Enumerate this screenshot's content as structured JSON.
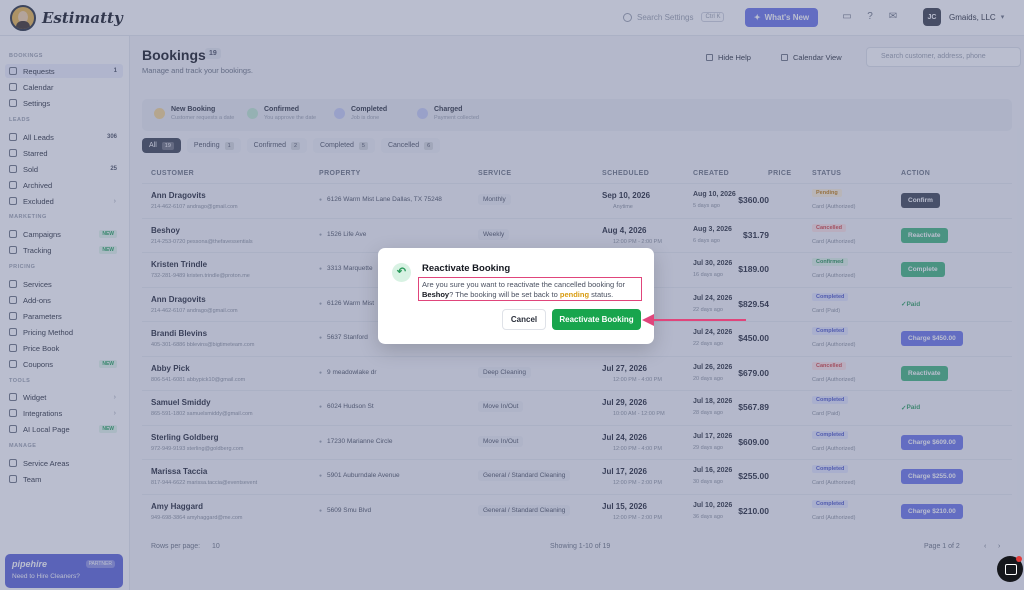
{
  "app": {
    "name": "Estimatty"
  },
  "topbar": {
    "search_placeholder": "Search Settings",
    "shortcut": "Ctrl K",
    "whats_new": "What's New",
    "account_initials": "JC",
    "account_name": "Gmaids, LLC"
  },
  "sidebar": {
    "sections": {
      "bookings": "BOOKINGS",
      "leads": "LEADS",
      "marketing": "MARKETING",
      "pricing": "PRICING",
      "tools": "TOOLS",
      "manage": "MANAGE"
    },
    "items": [
      {
        "label": "Requests",
        "badge": "1"
      },
      {
        "label": "Calendar"
      },
      {
        "label": "Settings"
      },
      {
        "label": "All Leads",
        "badge": "306"
      },
      {
        "label": "Starred"
      },
      {
        "label": "Sold",
        "badge": "25"
      },
      {
        "label": "Archived"
      },
      {
        "label": "Excluded"
      },
      {
        "label": "Campaigns",
        "new": "NEW"
      },
      {
        "label": "Tracking",
        "new": "NEW"
      },
      {
        "label": "Services"
      },
      {
        "label": "Add-ons"
      },
      {
        "label": "Parameters"
      },
      {
        "label": "Pricing Method"
      },
      {
        "label": "Price Book"
      },
      {
        "label": "Coupons",
        "new": "NEW"
      },
      {
        "label": "Widget"
      },
      {
        "label": "Integrations"
      },
      {
        "label": "AI Local Page",
        "new": "NEW"
      },
      {
        "label": "Service Areas"
      },
      {
        "label": "Team"
      }
    ],
    "promo": {
      "logo": "pipehire",
      "tag": "PARTNER",
      "text": "Need to Hire Cleaners?"
    }
  },
  "main": {
    "title": "Bookings",
    "title_count": "19",
    "subtitle": "Manage and track your bookings.",
    "hide_help": "Hide Help",
    "calendar_view": "Calendar View",
    "search_placeholder": "Search customer, address, phone",
    "steps": [
      {
        "title": "New Booking",
        "desc": "Customer requests a date",
        "color": "#f6d690"
      },
      {
        "title": "Confirmed",
        "desc": "You approve the date",
        "color": "#bfe8cf"
      },
      {
        "title": "Completed",
        "desc": "Job is done",
        "color": "#c7cdf5"
      },
      {
        "title": "Charged",
        "desc": "Payment collected",
        "color": "#c7cdf5"
      }
    ],
    "filters": [
      {
        "label": "All",
        "count": "19"
      },
      {
        "label": "Pending",
        "count": "1"
      },
      {
        "label": "Confirmed",
        "count": "2"
      },
      {
        "label": "Completed",
        "count": "5"
      },
      {
        "label": "Cancelled",
        "count": "6"
      }
    ],
    "columns": [
      "CUSTOMER",
      "PROPERTY",
      "SERVICE",
      "SCHEDULED",
      "CREATED",
      "PRICE",
      "STATUS",
      "ACTION"
    ],
    "rows": [
      {
        "name": "Ann Dragovits",
        "phone": "214-462-6107",
        "email": "andrago@gmail.com",
        "property": "6126 Warm Mist Lane Dallas, TX 75248",
        "service": "Monthly",
        "date": "Sep 10, 2026",
        "time": "Anytime",
        "created": "Aug 10, 2026",
        "ago": "5 days ago",
        "price": "$360.00",
        "status": "Pending",
        "card": "Card (Authorized)",
        "action": "Confirm",
        "action_style": "dark"
      },
      {
        "name": "Beshoy",
        "phone": "214-253-0720",
        "email": "pessona@thefavessentials",
        "property": "1526 Life Ave",
        "service": "Weekly",
        "date": "Aug 4, 2026",
        "time": "12:00 PM - 2:00 PM",
        "created": "Aug 3, 2026",
        "ago": "6 days ago",
        "price": "$31.79",
        "status": "Cancelled",
        "card": "Card (Authorized)",
        "action": "Reactivate",
        "action_style": "green"
      },
      {
        "name": "Kristen Trindle",
        "phone": "732-281-9489",
        "email": "kristen.trindle@proton.me",
        "property": "3313 Marquette",
        "service": "",
        "date": "",
        "time": "",
        "created": "Jul 30, 2026",
        "ago": "16 days ago",
        "price": "$189.00",
        "status": "Confirmed",
        "card": "Card (Authorized)",
        "action": "Complete",
        "action_style": "green"
      },
      {
        "name": "Ann Dragovits",
        "phone": "214-462-6107",
        "email": "andrago@gmail.com",
        "property": "6126 Warm Mist",
        "service": "",
        "date": "",
        "time": "",
        "created": "Jul 24, 2026",
        "ago": "22 days ago",
        "price": "$829.54",
        "status": "Completed",
        "card": "Card (Paid)",
        "action": "Paid",
        "action_style": "paid"
      },
      {
        "name": "Brandi Blevins",
        "phone": "405-301-6886",
        "email": "bblevins@bigtimeteam.com",
        "property": "5637 Stanford",
        "service": "",
        "date": "",
        "time": "",
        "created": "Jul 24, 2026",
        "ago": "22 days ago",
        "price": "$450.00",
        "status": "Completed",
        "card": "Card (Authorized)",
        "action": "Charge $450.00",
        "action_style": "purple"
      },
      {
        "name": "Abby Pick",
        "phone": "806-541-6081",
        "email": "abbypick10@gmail.com",
        "property": "9 meadowlake dr",
        "service": "Deep Cleaning",
        "date": "Jul 27, 2026",
        "time": "12:00 PM - 4:00 PM",
        "created": "Jul 26, 2026",
        "ago": "20 days ago",
        "price": "$679.00",
        "status": "Cancelled",
        "card": "Card (Authorized)",
        "action": "Reactivate",
        "action_style": "green"
      },
      {
        "name": "Samuel Smiddy",
        "phone": "865-591-1802",
        "email": "samuelsmiddy@gmail.com",
        "property": "6024 Hudson St",
        "service": "Move In/Out",
        "date": "Jul 29, 2026",
        "time": "10:00 AM - 12:00 PM",
        "created": "Jul 18, 2026",
        "ago": "28 days ago",
        "price": "$567.89",
        "status": "Completed",
        "card": "Card (Paid)",
        "action": "Paid",
        "action_style": "paid"
      },
      {
        "name": "Sterling Goldberg",
        "phone": "972-949-9193",
        "email": "sterling@goldberg.com",
        "property": "17230 Marianne Circle",
        "service": "Move In/Out",
        "date": "Jul 24, 2026",
        "time": "12:00 PM - 4:00 PM",
        "created": "Jul 17, 2026",
        "ago": "29 days ago",
        "price": "$609.00",
        "status": "Completed",
        "card": "Card (Authorized)",
        "action": "Charge $609.00",
        "action_style": "purple"
      },
      {
        "name": "Marissa Taccia",
        "phone": "817-944-6622",
        "email": "marissa.taccia@eventsevent",
        "property": "5901 Auburndale Avenue",
        "service": "General / Standard Cleaning",
        "date": "Jul 17, 2026",
        "time": "12:00 PM - 2:00 PM",
        "created": "Jul 16, 2026",
        "ago": "30 days ago",
        "price": "$255.00",
        "status": "Completed",
        "card": "Card (Authorized)",
        "action": "Charge $255.00",
        "action_style": "purple"
      },
      {
        "name": "Amy Haggard",
        "phone": "949-698-3864",
        "email": "amyhaggard@me.com",
        "property": "5609 Smu Blvd",
        "service": "General / Standard Cleaning",
        "date": "Jul 15, 2026",
        "time": "12:00 PM - 2:00 PM",
        "created": "Jul 10, 2026",
        "ago": "36 days ago",
        "price": "$210.00",
        "status": "Completed",
        "card": "Card (Authorized)",
        "action": "Charge $210.00",
        "action_style": "purple"
      }
    ],
    "footer": {
      "rows_per_page_label": "Rows per page:",
      "rows_per_page_value": "10",
      "showing": "Showing 1-10 of 19",
      "page": "Page 1 of 2"
    }
  },
  "modal": {
    "title": "Reactivate Booking",
    "msg_pre": "Are you sure you want to reactivate the cancelled booking for",
    "msg_name": "Beshoy",
    "msg_mid": "? The booking will be set back to",
    "msg_status": "pending",
    "msg_post": "status.",
    "cancel": "Cancel",
    "confirm": "Reactivate Booking"
  },
  "colors": {
    "accent": "#6a74e8",
    "confirm_green": "#18a54d",
    "highlight_border": "#e0457b",
    "arrow": "#e0457b"
  }
}
